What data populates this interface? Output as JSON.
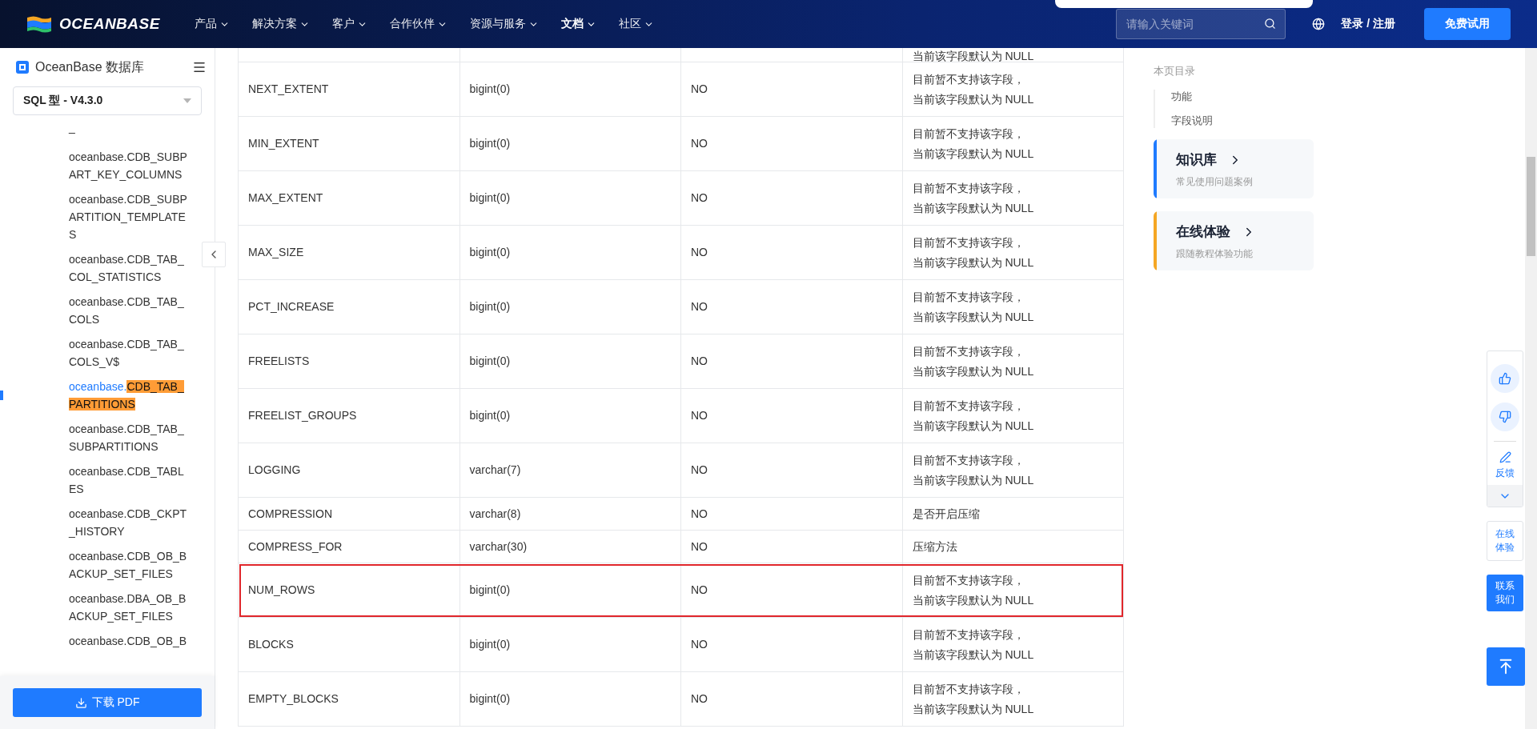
{
  "header": {
    "logo": "OCEANBASE",
    "nav": [
      {
        "label": "产品",
        "selected": false
      },
      {
        "label": "解决方案",
        "selected": false
      },
      {
        "label": "客户",
        "selected": false
      },
      {
        "label": "合作伙伴",
        "selected": false
      },
      {
        "label": "资源与服务",
        "selected": false
      },
      {
        "label": "文档",
        "selected": true
      },
      {
        "label": "社区",
        "selected": false
      }
    ],
    "search": {
      "placeholder": "请输入关键词"
    },
    "login": "登录 / 注册",
    "trial_button": "免费试用"
  },
  "sidebar": {
    "title": "OceanBase 数据库",
    "version": "SQL 型 - V4.3.0",
    "items": [
      {
        "text": "_",
        "selected": false
      },
      {
        "text": "oceanbase.CDB_SUBPART_KEY_COLUMNS",
        "selected": false
      },
      {
        "text": "oceanbase.CDB_SUBPARTITION_TEMPLATES",
        "selected": false
      },
      {
        "text": "oceanbase.CDB_TAB_COL_STATISTICS",
        "selected": false
      },
      {
        "text": "oceanbase.CDB_TAB_COLS",
        "selected": false
      },
      {
        "text": "oceanbase.CDB_TAB_COLS_V$",
        "selected": false
      },
      {
        "text": "oceanbase.",
        "match": "CDB_TAB_PARTITIONS",
        "selected": true
      },
      {
        "text": "oceanbase.CDB_TAB_SUBPARTITIONS",
        "selected": false
      },
      {
        "text": "oceanbase.CDB_TABLES",
        "selected": false
      },
      {
        "text": "oceanbase.CDB_CKPT_HISTORY",
        "selected": false
      },
      {
        "text": "oceanbase.CDB_OB_BACKUP_SET_FILES",
        "selected": false
      },
      {
        "text": "oceanbase.DBA_OB_BACKUP_SET_FILES",
        "selected": false
      },
      {
        "text": "oceanbase.CDB_OB_B",
        "selected": false
      }
    ],
    "download_button": "下载 PDF"
  },
  "table": {
    "top_remnant": "当前该字段默认为 NULL",
    "rows": [
      {
        "field": "NEXT_EXTENT",
        "type": "bigint(0)",
        "nullable": "NO",
        "description": "目前暂不支持该字段，当前该字段默认为 NULL",
        "highlighted": false
      },
      {
        "field": "MIN_EXTENT",
        "type": "bigint(0)",
        "nullable": "NO",
        "description": "目前暂不支持该字段，当前该字段默认为 NULL",
        "highlighted": false
      },
      {
        "field": "MAX_EXTENT",
        "type": "bigint(0)",
        "nullable": "NO",
        "description": "目前暂不支持该字段，当前该字段默认为 NULL",
        "highlighted": false
      },
      {
        "field": "MAX_SIZE",
        "type": "bigint(0)",
        "nullable": "NO",
        "description": "目前暂不支持该字段，当前该字段默认为 NULL",
        "highlighted": false
      },
      {
        "field": "PCT_INCREASE",
        "type": "bigint(0)",
        "nullable": "NO",
        "description": "目前暂不支持该字段，当前该字段默认为 NULL",
        "highlighted": false
      },
      {
        "field": "FREELISTS",
        "type": "bigint(0)",
        "nullable": "NO",
        "description": "目前暂不支持该字段，当前该字段默认为 NULL",
        "highlighted": false
      },
      {
        "field": "FREELIST_GROUPS",
        "type": "bigint(0)",
        "nullable": "NO",
        "description": "目前暂不支持该字段，当前该字段默认为 NULL",
        "highlighted": false
      },
      {
        "field": "LOGGING",
        "type": "varchar(7)",
        "nullable": "NO",
        "description": "目前暂不支持该字段，当前该字段默认为 NULL",
        "highlighted": false
      },
      {
        "field": "COMPRESSION",
        "type": "varchar(8)",
        "nullable": "NO",
        "description": "是否开启压缩",
        "highlighted": false
      },
      {
        "field": "COMPRESS_FOR",
        "type": "varchar(30)",
        "nullable": "NO",
        "description": "压缩方法",
        "highlighted": false
      },
      {
        "field": "NUM_ROWS",
        "type": "bigint(0)",
        "nullable": "NO",
        "description": "目前暂不支持该字段，当前该字段默认为 NULL",
        "highlighted": true
      },
      {
        "field": "BLOCKS",
        "type": "bigint(0)",
        "nullable": "NO",
        "description": "目前暂不支持该字段，当前该字段默认为 NULL",
        "highlighted": false
      },
      {
        "field": "EMPTY_BLOCKS",
        "type": "bigint(0)",
        "nullable": "NO",
        "description": "目前暂不支持该字段，当前该字段默认为 NULL",
        "highlighted": false
      }
    ]
  },
  "toc": {
    "title": "本页目录",
    "items": [
      {
        "label": "功能"
      },
      {
        "label": "字段说明"
      }
    ]
  },
  "cards": [
    {
      "title": "知识库",
      "subtitle": "常见使用问题案例",
      "color": "#1f7bff"
    },
    {
      "title": "在线体验",
      "subtitle": "跟随教程体验功能",
      "color": "#f5a623"
    }
  ],
  "float_bar": {
    "feedback": "反馈",
    "trial": "在线体验",
    "contact": "联系我们"
  }
}
